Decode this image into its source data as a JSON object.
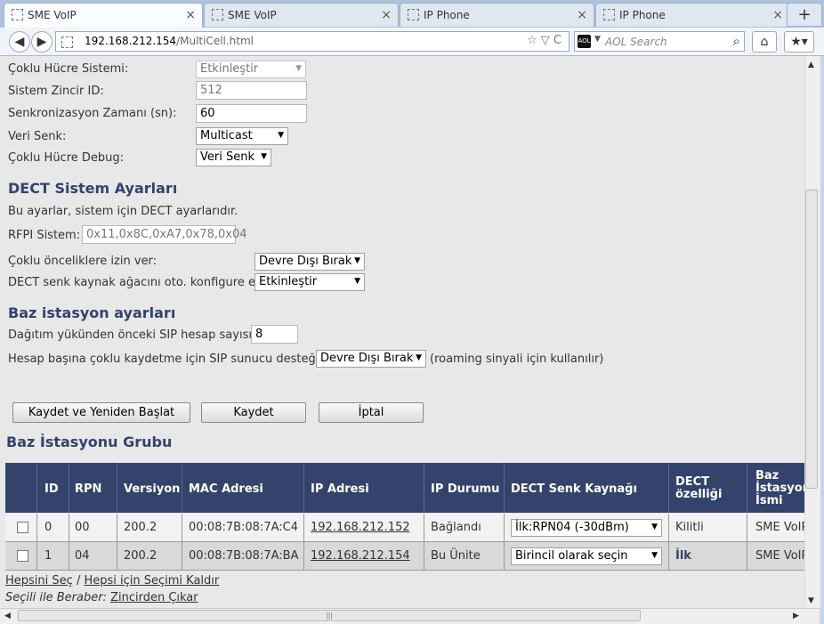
{
  "browser": {
    "tabs": [
      {
        "title": "SME VoIP",
        "close": "×"
      },
      {
        "title": "SME VoIP",
        "close": "×"
      },
      {
        "title": "IP Phone",
        "close": "×"
      },
      {
        "title": "IP Phone",
        "close": "×"
      }
    ],
    "new_tab": "+",
    "url_host": "192.168.212.154",
    "url_path": "/MultiCell.html",
    "url_controls": "☆ ▽ C",
    "search_engine": "AOL",
    "search_placeholder": "AOL Search"
  },
  "multicell": {
    "system_label": "Çoklu Hücre Sistemi:",
    "system_value": "Etkinleştir",
    "chain_id_label": "Sistem Zincir ID:",
    "chain_id_value": "512",
    "sync_time_label": "Senkronizasyon Zamanı (sn):",
    "sync_time_value": "60",
    "data_sync_label": "Veri Senk:",
    "data_sync_value": "Multicast",
    "debug_label": "Çoklu Hücre Debug:",
    "debug_value": "Veri Senk"
  },
  "dect": {
    "heading": "DECT Sistem Ayarları",
    "description": "Bu ayarlar, sistem için DECT ayarlarıdır.",
    "rfpi_label": "RFPI Sistem:",
    "rfpi_value": "0x11,0x8C,0xA7,0x78,0x04",
    "multi_primary_label": "Çoklu önceliklere izin ver:",
    "multi_primary_value": "Devre Dışı Bırak",
    "auto_config_label": "DECT senk kaynak ağacını oto. konfigure et",
    "auto_config_value": "Etkinleştir"
  },
  "base": {
    "heading": "Baz istasyon ayarları",
    "sip_count_label": "Dağıtım yükünden önceki SIP hesap sayısı:",
    "sip_count_value": "8",
    "sip_support_label": "Hesap başına çoklu kaydetme için SIP sunucu desteği:",
    "sip_support_value": "Devre Dışı Bırak",
    "sip_support_note": "(roaming sinyali için kullanılır)"
  },
  "buttons": {
    "save_restart": "Kaydet ve Yeniden Başlat",
    "save": "Kaydet",
    "cancel": "İptal"
  },
  "group": {
    "heading": "Baz İstasyonu Grubu",
    "columns": [
      "ID",
      "RPN",
      "Versiyon",
      "MAC Adresi",
      "IP Adresi",
      "IP Durumu",
      "DECT Senk Kaynağı",
      "DECT özelliği",
      "Baz İstasyon İsmi"
    ],
    "rows": [
      {
        "id": "0",
        "rpn": "00",
        "version": "200.2",
        "mac": "00:08:7B:08:7A:C4",
        "ip": "192.168.212.152",
        "status": "Bağlandı",
        "sync": "İlk:RPN04 (-30dBm)",
        "feature": "Kilitli",
        "name": "SME VoIP"
      },
      {
        "id": "1",
        "rpn": "04",
        "version": "200.2",
        "mac": "00:08:7B:08:7A:BA",
        "ip": "192.168.212.154",
        "status": "Bu Ünite",
        "sync": "Birincil olarak seçin",
        "feature": "İlk",
        "name": "SME VoIP"
      }
    ],
    "select_all": "Hepsini Seç",
    "separator": "/",
    "deselect_all": "Hepsi için Seçimi Kaldır",
    "selected_label": "Seçili ile Beraber:",
    "remove_chain": "Zincirden Çıkar"
  }
}
